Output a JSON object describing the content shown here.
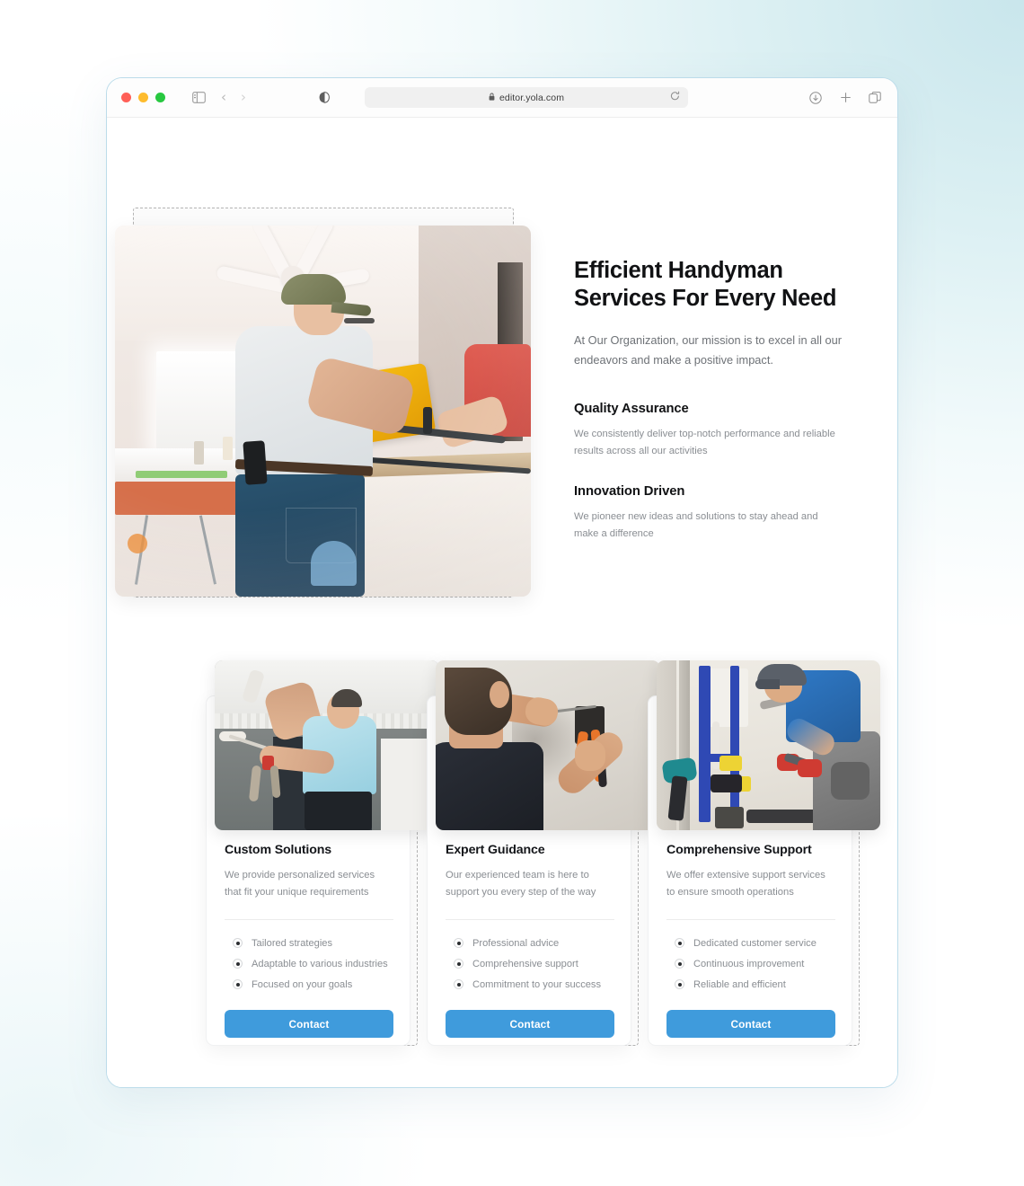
{
  "browser": {
    "url": "editor.yola.com",
    "lock_icon": "lock-icon",
    "reload_icon": "reload-icon",
    "sidebar_icon": "sidebar-toggle-icon",
    "back_icon": "chevron-left-icon",
    "forward_icon": "chevron-right-icon",
    "shield_icon": "reader-mode-icon",
    "download_icon": "download-icon",
    "new_tab_icon": "plus-icon",
    "tabs_icon": "tab-overview-icon",
    "traffic_lights": [
      "close",
      "minimize",
      "zoom"
    ]
  },
  "hero": {
    "title": "Efficient Handyman Services For Every Need",
    "subtitle": "At Our Organization, our mission is to excel in all our endeavors and make a positive impact.",
    "features": [
      {
        "heading": "Quality Assurance",
        "body": "We consistently deliver top-notch performance and reliable results across all our activities"
      },
      {
        "heading": "Innovation Driven",
        "body": "We pioneer new ideas and solutions to stay ahead and make a difference"
      }
    ],
    "image_alt": "carpenter-using-miter-saw-in-kitchen"
  },
  "cards": [
    {
      "title": "Custom Solutions",
      "description": "We provide personalized services that fit your unique requirements",
      "bullets": [
        "Tailored strategies",
        "Adaptable to various industries",
        "Focused on your goals"
      ],
      "button": "Contact",
      "image_alt": "painter-reaching-ceiling-with-roller"
    },
    {
      "title": "Expert Guidance",
      "description": "Our experienced team is here to support you every step of the way",
      "bullets": [
        "Professional advice",
        "Comprehensive support",
        "Commitment to your success"
      ],
      "button": "Contact",
      "image_alt": "electrician-wiring-outlet-with-strippers"
    },
    {
      "title": "Comprehensive Support",
      "description": "We offer extensive support services to ensure smooth operations",
      "bullets": [
        "Dedicated customer service",
        "Continuous improvement",
        "Reliable and efficient"
      ],
      "button": "Contact",
      "image_alt": "plumber-installing-pipes-with-red-gloves"
    }
  ],
  "colors": {
    "accent_button": "#3f9bdc",
    "heading": "#111214",
    "body_text": "#8a8e93",
    "window_border": "#bcdcea",
    "selection_dashed": "#b6b6b6",
    "backdrop_top_right": "#cfe9ee"
  }
}
